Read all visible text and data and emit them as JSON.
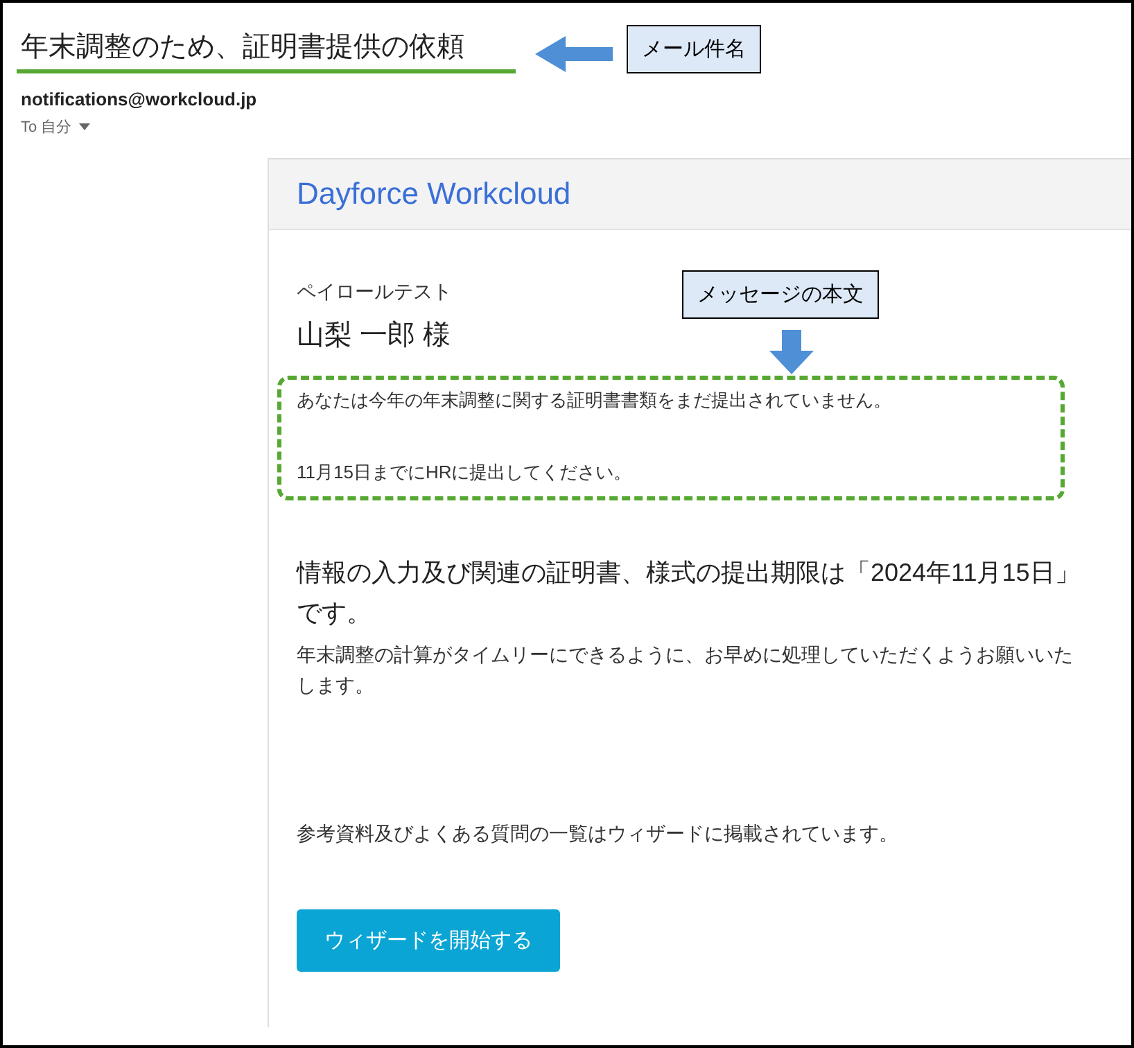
{
  "email": {
    "subject": "年末調整のため、証明書提供の依頼",
    "sender": "notifications@workcloud.jp",
    "recipient": "To 自分"
  },
  "card": {
    "brand": "Dayforce Workcloud",
    "company": "ペイロールテスト",
    "addressee": "山梨 一郎 様",
    "message_lines": [
      "あなたは今年の年末調整に関する証明書書類をまだ提出されていません。",
      "11月15日までにHRに提出してください。"
    ],
    "deadline": "情報の入力及び関連の証明書、様式の提出期限は「2024年11月15日」です。",
    "request": "年末調整の計算がタイムリーにできるように、お早めに処理していただくようお願いいたします。",
    "reference": "参考資料及びよくある質問の一覧はウィザードに掲載されています。",
    "button": "ウィザードを開始する"
  },
  "annotations": [
    {
      "kind": "subject",
      "label": "メール件名"
    },
    {
      "kind": "body",
      "label": "メッセージの本文"
    }
  ]
}
